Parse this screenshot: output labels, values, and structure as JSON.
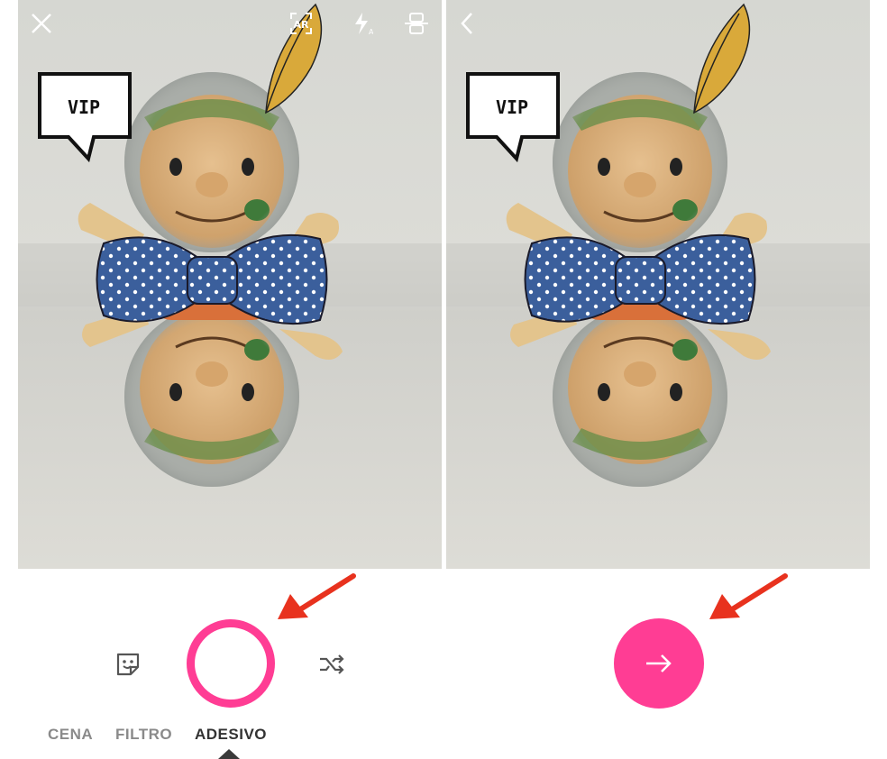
{
  "left_screen": {
    "toolbar": {
      "close_icon": "close-icon",
      "ar_icon": "ar-icon",
      "flash_icon": "flash-auto-icon",
      "switch_camera_icon": "switch-camera-icon"
    },
    "sticker_text": "VIP",
    "tools": {
      "sticker_icon": "sticker-icon",
      "shuffle_icon": "shuffle-icon"
    },
    "tabs": [
      {
        "label": "CENA",
        "active": false
      },
      {
        "label": "FILTRO",
        "active": false
      },
      {
        "label": "ADESIVO",
        "active": true
      }
    ]
  },
  "right_screen": {
    "toolbar": {
      "back_icon": "chevron-left-icon"
    },
    "sticker_text": "VIP",
    "next_icon": "arrow-right-icon"
  },
  "colors": {
    "accent": "#ff3d94",
    "annotation_arrow": "#e8321e",
    "bow_tie": "#3b5f9c",
    "tab_inactive": "#8a8a8a",
    "tab_active": "#333333"
  }
}
